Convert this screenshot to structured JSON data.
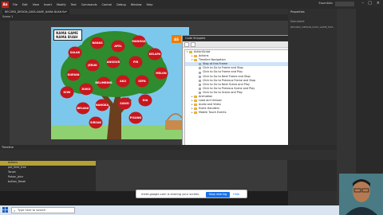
{
  "app": {
    "logo": "An",
    "menu": [
      "File",
      "Edit",
      "View",
      "Insert",
      "Modify",
      "Text",
      "Commands",
      "Control",
      "Debug",
      "Window",
      "Help"
    ],
    "workspace": "Essentials"
  },
  "document": {
    "tab_label": "RECORD_DESIGN_DATA.GAME_NAMA BUAH.fla*",
    "scene": "Scene 1"
  },
  "stage": {
    "title_card": [
      "NAMA GAME",
      "NAMA BUAH"
    ],
    "fruits": [
      {
        "label": "SALAK"
      },
      {
        "label": "NANAS"
      },
      {
        "label": "APEL"
      },
      {
        "label": "MANGGA"
      },
      {
        "label": "KELAPA"
      },
      {
        "label": "DURIAN"
      },
      {
        "label": "JERUK"
      },
      {
        "label": "ANGGUR"
      },
      {
        "label": "PIR"
      },
      {
        "label": "MELON"
      },
      {
        "label": "KIWI"
      },
      {
        "label": "DUKU"
      },
      {
        "label": "BELIMBING"
      },
      {
        "label": "AKU"
      },
      {
        "label": "SEPA"
      },
      {
        "label": "BELUAU"
      },
      {
        "label": "NANGKA"
      },
      {
        "label": "SAWO"
      },
      {
        "label": "DIA"
      },
      {
        "label": "SIRSAK"
      },
      {
        "label": "PISANG"
      }
    ],
    "badge": "AS"
  },
  "dialog": {
    "title": "Code Snippets",
    "rows": [
      {
        "text": "ActionScript",
        "level": 0,
        "kind": "folder",
        "open": true
      },
      {
        "text": "Actions",
        "level": 1,
        "kind": "folder"
      },
      {
        "text": "Timeline Navigation",
        "level": 1,
        "kind": "folder",
        "open": true
      },
      {
        "text": "Stop at this Frame",
        "level": 2,
        "kind": "snip",
        "selected": true
      },
      {
        "text": "Click to Go to Frame and Stop",
        "level": 2,
        "kind": "snip"
      },
      {
        "text": "Click to Go to Frame and Play",
        "level": 2,
        "kind": "snip"
      },
      {
        "text": "Click to Go to Next Frame and Stop",
        "level": 2,
        "kind": "snip"
      },
      {
        "text": "Click to Go to Previous Frame and Stop",
        "level": 2,
        "kind": "snip"
      },
      {
        "text": "Click to Go to Next Scene and Play",
        "level": 2,
        "kind": "snip"
      },
      {
        "text": "Click to Go to Previous Scene and Play",
        "level": 2,
        "kind": "snip"
      },
      {
        "text": "Click to Go to Scene and Play",
        "level": 2,
        "kind": "snip"
      },
      {
        "text": "Animation",
        "level": 1,
        "kind": "folder"
      },
      {
        "text": "Load and Unload",
        "level": 1,
        "kind": "folder"
      },
      {
        "text": "Audio and Video",
        "level": 1,
        "kind": "folder"
      },
      {
        "text": "Event Handlers",
        "level": 1,
        "kind": "folder"
      },
      {
        "text": "Mobile Touch Events",
        "level": 1,
        "kind": "folder"
      }
    ]
  },
  "right_panel": {
    "header": "Properties",
    "doc_label": "Document",
    "file_name": "RECORD_DESIGN_DATA_GAME_MAT..."
  },
  "timeline": {
    "tab": "Timeline",
    "layers": [
      {
        "name": "Actions",
        "selected": true
      },
      {
        "name": "pot_feed_tree",
        "selected": false
      },
      {
        "name": "Tanah",
        "selected": false
      },
      {
        "name": "Pohon_Jalur",
        "selected": false
      },
      {
        "name": "button_Tanah",
        "selected": false
      }
    ]
  },
  "share": {
    "text": "meet.google.com is sharing your screen.",
    "stop": "Stop sharing",
    "hide": "Hide"
  },
  "taskbar": {
    "search_placeholder": "Type here to search"
  }
}
